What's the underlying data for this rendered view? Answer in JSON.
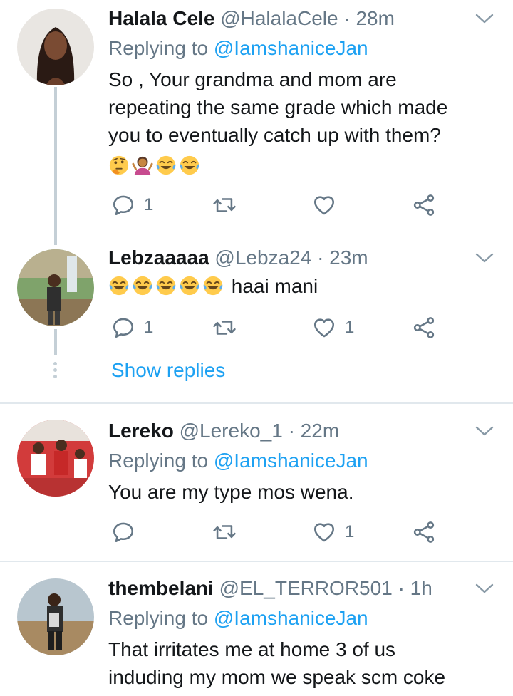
{
  "tweets": [
    {
      "name": "Halala Cele",
      "handle": "@HalalaCele",
      "time": "· 28m",
      "replying_prefix": "Replying to",
      "replying_to": "@IamshaniceJan",
      "text": "So , Your grandma and mom are repeating the same grade which made you to eventually catch up with them?",
      "emojis": [
        "thinking-face-emoji",
        "shrugging-woman-emoji",
        "tears-of-joy-emoji",
        "tears-of-joy-emoji"
      ],
      "reply_count": "1",
      "retweet_count": "",
      "like_count": ""
    },
    {
      "name": "Lebzaaaaa",
      "handle": "@Lebza24",
      "time": "· 23m",
      "text": "haai mani",
      "emojis": [
        "tears-of-joy-emoji",
        "tears-of-joy-emoji",
        "tears-of-joy-emoji",
        "tears-of-joy-emoji",
        "tears-of-joy-emoji"
      ],
      "reply_count": "1",
      "retweet_count": "",
      "like_count": "1",
      "show_replies": "Show replies"
    },
    {
      "name": "Lereko",
      "handle": "@Lereko_1",
      "time": "· 22m",
      "replying_prefix": "Replying to",
      "replying_to": "@IamshaniceJan",
      "text": "You are my type mos wena.",
      "reply_count": "",
      "retweet_count": "",
      "like_count": "1"
    },
    {
      "name": "thembelani",
      "handle": "@EL_TERROR501",
      "time": "· 1h",
      "replying_prefix": "Replying to",
      "replying_to": "@IamshaniceJan",
      "text_line1": "That irritates me at home 3 of us",
      "text_line2": "induding my mom we speak scm coke"
    }
  ],
  "colors": {
    "link": "#1da1f2",
    "muted": "#657786",
    "divider": "#e1e8ed",
    "thread_line": "#c4cfd6",
    "text": "#14171a"
  },
  "icons": [
    "reply-icon",
    "retweet-icon",
    "like-icon",
    "share-icon",
    "caret-down-icon"
  ]
}
